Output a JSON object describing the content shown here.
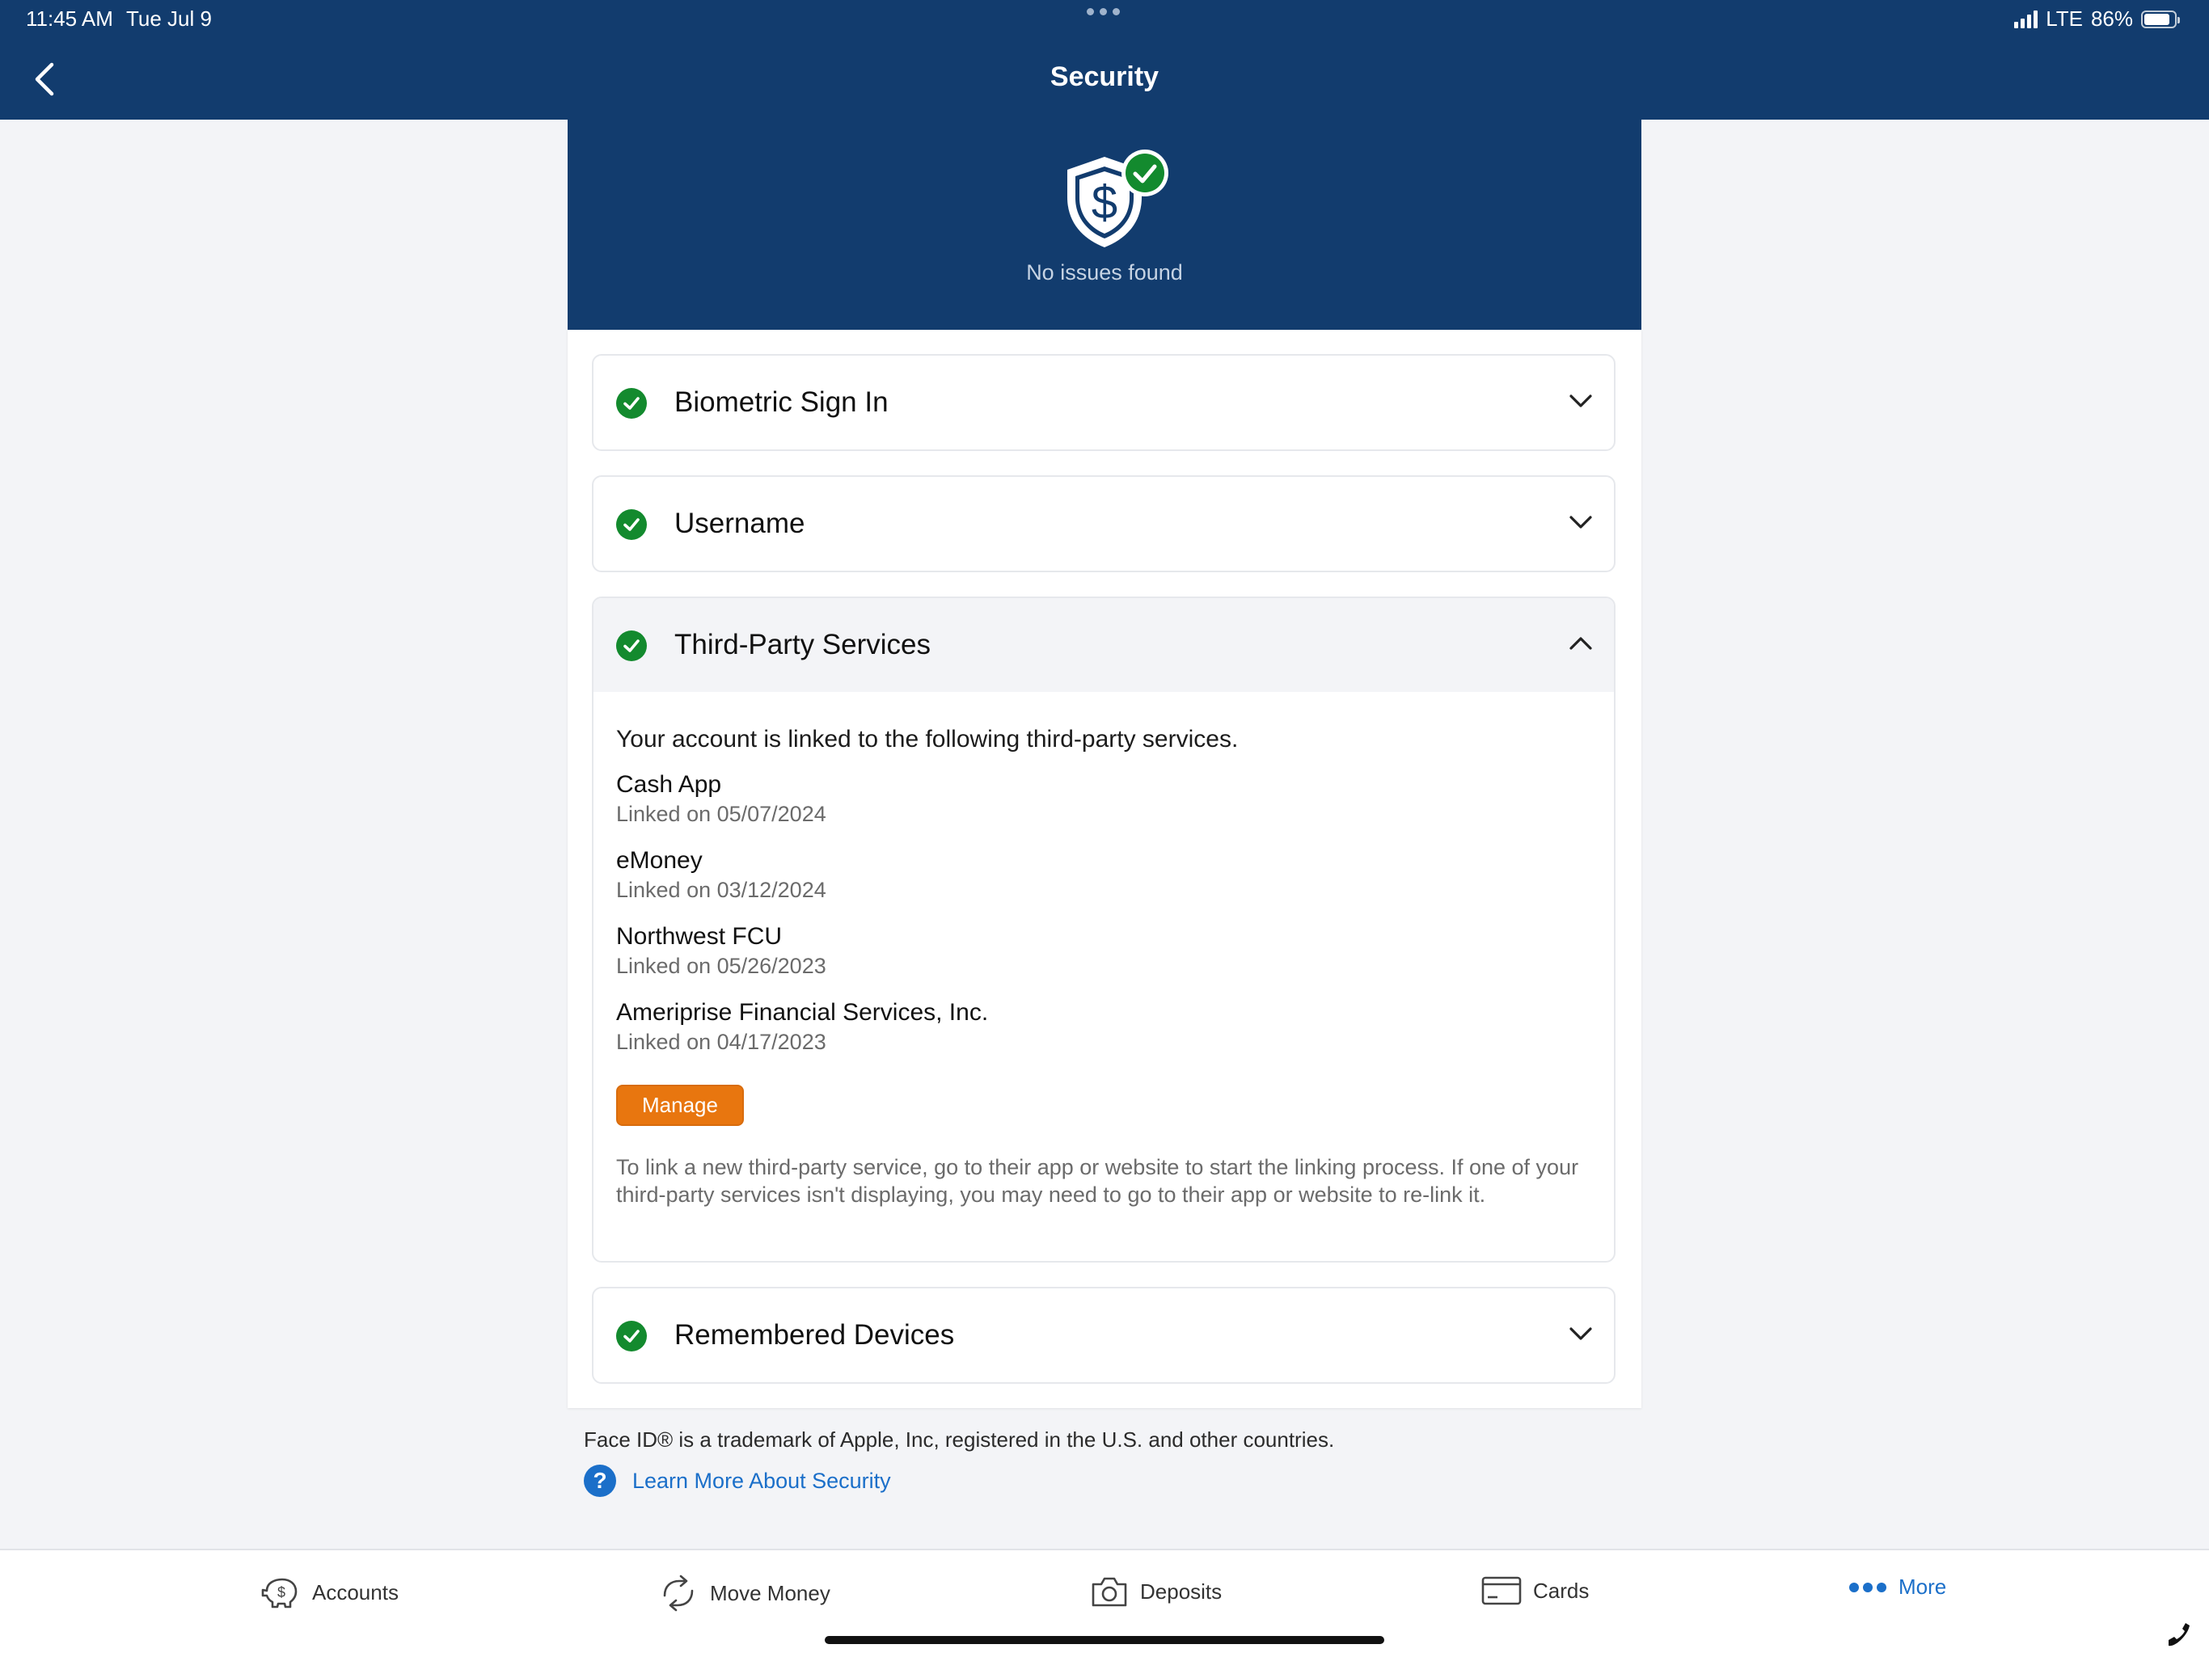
{
  "status_bar": {
    "time": "11:45 AM",
    "date": "Tue Jul 9",
    "network": "LTE",
    "battery": "86%",
    "battery_level": 0.86
  },
  "nav": {
    "title": "Security",
    "back_icon": "chevron-left-icon"
  },
  "hero": {
    "icon": "shield-dollar-check-icon",
    "status_text": "No issues found"
  },
  "sections": {
    "biometric": {
      "title": "Biometric Sign In",
      "expanded": false
    },
    "username": {
      "title": "Username",
      "expanded": false
    },
    "third_party": {
      "title": "Third-Party Services",
      "expanded": true,
      "intro": "Your account is linked to the following third-party services.",
      "services": [
        {
          "name": "Cash App",
          "linked": "Linked on 05/07/2024"
        },
        {
          "name": "eMoney",
          "linked": "Linked on 03/12/2024"
        },
        {
          "name": "Northwest FCU",
          "linked": "Linked on 05/26/2023"
        },
        {
          "name": "Ameriprise Financial Services, Inc.",
          "linked": "Linked on 04/17/2023"
        }
      ],
      "manage_label": "Manage",
      "help_text": "To link a new third-party service, go to their app or website to start the linking process. If one of your third-party services isn't displaying, you may need to go to their app or website to re-link it."
    },
    "remembered_devices": {
      "title": "Remembered Devices",
      "expanded": false
    }
  },
  "footer": {
    "trademark": "Face ID® is a trademark of Apple, Inc, registered in the U.S. and other countries.",
    "learn_more": "Learn More About Security"
  },
  "tabbar": {
    "tabs": [
      {
        "label": "Accounts",
        "icon": "piggy-bank-icon",
        "active": false
      },
      {
        "label": "Move Money",
        "icon": "transfer-arrows-icon",
        "active": false
      },
      {
        "label": "Deposits",
        "icon": "camera-icon",
        "active": false
      },
      {
        "label": "Cards",
        "icon": "card-icon",
        "active": false
      },
      {
        "label": "More",
        "icon": "more-dots-icon",
        "active": true
      }
    ]
  },
  "colors": {
    "brand_navy": "#123c6e",
    "success_green": "#138a2e",
    "accent_orange": "#e8760f",
    "link_blue": "#1b6fc9"
  }
}
